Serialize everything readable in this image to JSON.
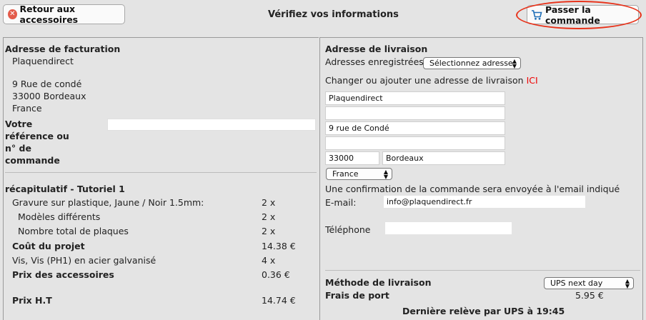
{
  "header": {
    "back_label": "Retour aux accessoires",
    "title": "Vérifiez vos informations",
    "order_label": "Passer la commande",
    "colors": {
      "accent_red": "#e8321a",
      "cart_blue": "#1f6fb8"
    }
  },
  "billing": {
    "heading": "Adresse de facturation",
    "company": "Plaquendirect",
    "street": "9 Rue de condé",
    "city": "33000 Bordeaux",
    "country": "France",
    "ref_label_1": "Votre",
    "ref_label_2": "référence ou",
    "ref_label_3": "n° de",
    "ref_label_4": "commande",
    "ref_value": ""
  },
  "summary": {
    "heading": "récapitulatif - Tutoriel 1",
    "rows": [
      {
        "label": "Gravure sur plastique, Jaune / Noir 1.5mm:",
        "value": "2 x"
      },
      {
        "label": "Modèles différents",
        "value": "2 x"
      },
      {
        "label": "Nombre total de plaques",
        "value": "2 x"
      },
      {
        "label": "Coût du projet",
        "value": "14.38 €"
      },
      {
        "label": "Vis, Vis (PH1) en acier galvanisé",
        "value": "4 x"
      },
      {
        "label": "Prix des accessoires",
        "value": "0.36 €"
      },
      {
        "label": "Prix H.T",
        "value": "14.74 €"
      }
    ]
  },
  "shipping": {
    "heading": "Adresse de livraison",
    "saved_label": "Adresses enregistrées",
    "saved_select": "Sélectionnez adresse",
    "change_text": "Changer ou ajouter une adresse de livraison",
    "change_link": "ICI",
    "fields": {
      "line1": "Plaquendirect",
      "line2": "",
      "line3": "9 rue de Condé",
      "line4": "",
      "zip": "33000",
      "city": "Bordeaux"
    },
    "country_select": "France",
    "confirm_text": "Une confirmation de la commande sera envoyée à l'email indiqué",
    "email_label": "E-mail:",
    "email_value": "info@plaquendirect.fr",
    "phone_label": "Téléphone",
    "phone_value": "",
    "method_label": "Méthode de livraison",
    "method_select": "UPS next day",
    "fee_label": "Frais de port",
    "fee_value": "5.95 €",
    "pickup_text": "Dernière relève par UPS à 19:45"
  }
}
